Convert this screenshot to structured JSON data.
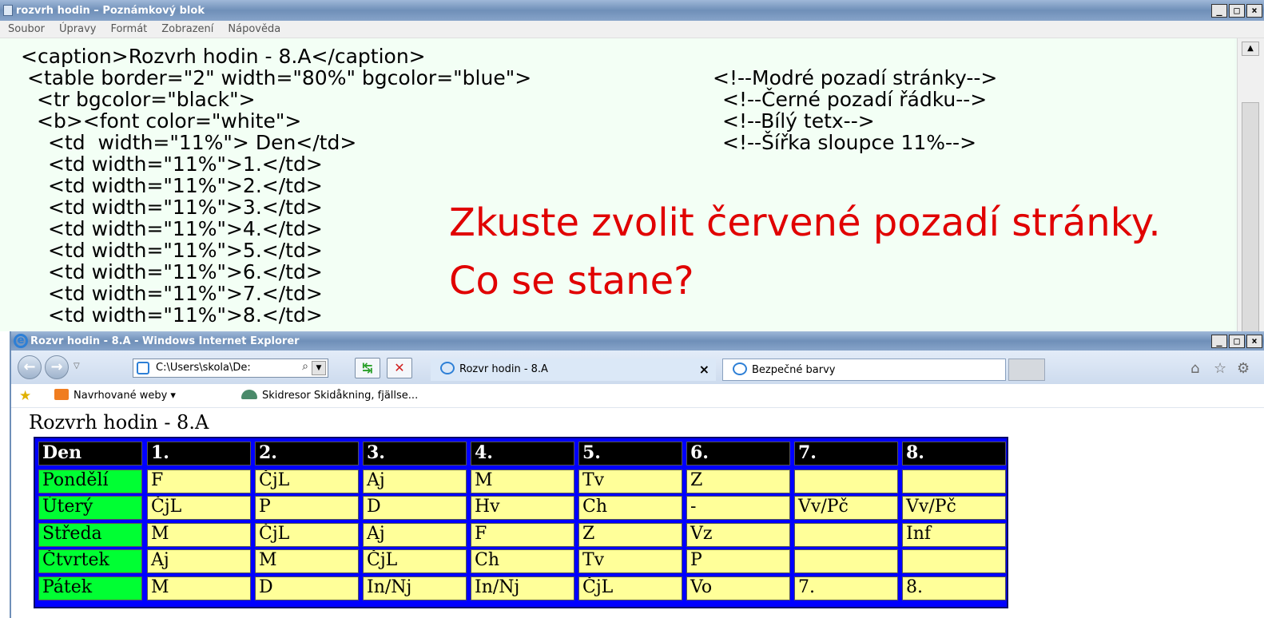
{
  "notepad": {
    "title": "rozvrh hodin – Poznámkový blok",
    "window_buttons": [
      "_",
      "□",
      "×"
    ],
    "menu": [
      "Soubor",
      "Úpravy",
      "Formát",
      "Zobrazení",
      "Nápověda"
    ],
    "code_lines": [
      "<caption>Rozvrh hodin - 8.A</caption>",
      "<table border=\"2\" width=\"80%\" bgcolor=\"blue\">",
      "<tr bgcolor=\"black\">",
      "<b><font color=\"white\">",
      "<td  width=\"11%\"> Den</td>",
      "<td width=\"11%\">1.</td>",
      "<td width=\"11%\">2.</td>",
      "<td width=\"11%\">3.</td>",
      "<td width=\"11%\">4.</td>",
      "<td width=\"11%\">5.</td>",
      "<td width=\"11%\">6.</td>",
      "<td width=\"11%\">7.</td>",
      "<td width=\"11%\">8.</td>"
    ],
    "comments": [
      "<!--Modré pozadí stránky-->",
      "<!--Černé pozadí řádku-->",
      "<!--Bílý tetx-->",
      "<!--Šířka sloupce 11%-->"
    ]
  },
  "overlay": {
    "line1": "Zkuste zvolit červené pozadí stránky.",
    "line2": "Co se stane?",
    "color": "#e00000"
  },
  "ie": {
    "title": "Rozvr hodin - 8.A - Windows Internet Explorer",
    "window_buttons": [
      "_",
      "□",
      "×"
    ],
    "address": "C:\\Users\\skola\\De:",
    "tabs": [
      {
        "label": "Rozvr hodin - 8.A",
        "active": true
      },
      {
        "label": "Bezpečné barvy",
        "active": false
      }
    ],
    "tab_close": "×",
    "favorites": {
      "suggested": "Navrhované weby ▾",
      "link": "Skidresor Skidåkning, fjällse..."
    },
    "page": {
      "caption": "Rozvrh hodin - 8.A",
      "header": [
        "Den",
        "1.",
        "2.",
        "3.",
        "4.",
        "5.",
        "6.",
        "7.",
        "8."
      ],
      "rows": [
        [
          "Pondělí",
          "F",
          "ČjL",
          "Aj",
          "M",
          "Tv",
          "Z",
          "",
          ""
        ],
        [
          "Úterý",
          "ČjL",
          "P",
          "D",
          "Hv",
          "Ch",
          "-",
          "Vv/Pč",
          "Vv/Pč"
        ],
        [
          "Středa",
          "M",
          "ČjL",
          "Aj",
          "F",
          "Z",
          "Vz",
          "",
          "Inf"
        ],
        [
          "Čtvrtek",
          "Aj",
          "M",
          "ČjL",
          "Ch",
          "Tv",
          "P",
          "",
          ""
        ],
        [
          "Pátek",
          "M",
          "D",
          "In/Nj",
          "In/Nj",
          "ČjL",
          "Vo",
          "7.",
          "8."
        ]
      ],
      "colors": {
        "table_bg": "#0000ff",
        "header_bg": "#000000",
        "day_bg": "#00ff33",
        "cell_bg": "#ffff99"
      }
    }
  }
}
